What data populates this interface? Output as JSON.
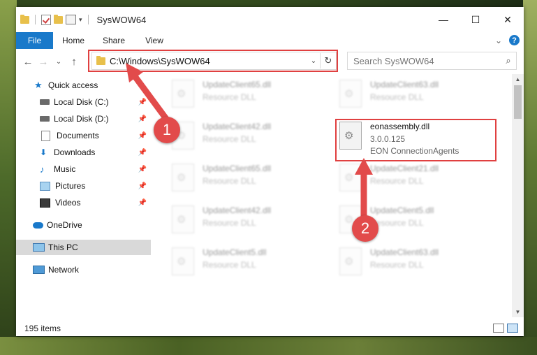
{
  "window": {
    "title": "SysWOW64",
    "controls": {
      "minimize": "—",
      "maximize": "☐",
      "close": "✕"
    }
  },
  "ribbon": {
    "tabs": [
      "File",
      "Home",
      "Share",
      "View"
    ],
    "help": "?",
    "expand": "⌄"
  },
  "navigation": {
    "back": "←",
    "forward": "→",
    "recent": "⌄",
    "up": "↑",
    "address": "C:\\Windows\\SysWOW64",
    "dropdown": "⌄",
    "refresh": "↻"
  },
  "search": {
    "placeholder": "Search SysWOW64",
    "icon": "⌕"
  },
  "sidebar": {
    "items": [
      {
        "label": "Quick access",
        "icon": "star-icon"
      },
      {
        "label": "Local Disk (C:)",
        "icon": "disk-icon",
        "pinned": true
      },
      {
        "label": "Local Disk (D:)",
        "icon": "disk-icon",
        "pinned": true
      },
      {
        "label": "Documents",
        "icon": "document-icon",
        "pinned": true
      },
      {
        "label": "Downloads",
        "icon": "download-icon",
        "pinned": true
      },
      {
        "label": "Music",
        "icon": "music-icon",
        "pinned": true
      },
      {
        "label": "Pictures",
        "icon": "pictures-icon",
        "pinned": true
      },
      {
        "label": "Videos",
        "icon": "videos-icon",
        "pinned": true
      },
      {
        "label": "OneDrive",
        "icon": "cloud-icon"
      },
      {
        "label": "This PC",
        "icon": "computer-icon",
        "selected": true
      },
      {
        "label": "Network",
        "icon": "network-icon"
      }
    ],
    "pin_glyph": "📌",
    "star_glyph": "★",
    "download_glyph": "⬇",
    "music_glyph": "♪"
  },
  "files": [
    {
      "name": "UpdateClient65.dll",
      "desc": "Resource DLL"
    },
    {
      "name": "UpdateClient63.dll",
      "desc": "Resource DLL"
    },
    {
      "name": "UpdateClient42.dll",
      "desc": "Resource DLL"
    },
    {
      "name": "UpdateClient65.dll",
      "desc": "Resource DLL"
    },
    {
      "name": "UpdateClient21.dll",
      "desc": "Resource DLL"
    },
    {
      "name": "UpdateClient42.dll",
      "desc": "Resource DLL"
    },
    {
      "name": "UpdateClient5.dll",
      "desc": "Resource DLL"
    },
    {
      "name": "UpdateClient5.dll",
      "desc": "Resource DLL"
    },
    {
      "name": "UpdateClient63.dll",
      "desc": "Resource DLL"
    }
  ],
  "highlighted_file": {
    "name": "eonassembly.dll",
    "version": "3.0.0.125",
    "company": "EON ConnectionAgents"
  },
  "annotations": {
    "step1": "1",
    "step2": "2",
    "color": "#e24b4b"
  },
  "status": {
    "count": "195 items"
  }
}
